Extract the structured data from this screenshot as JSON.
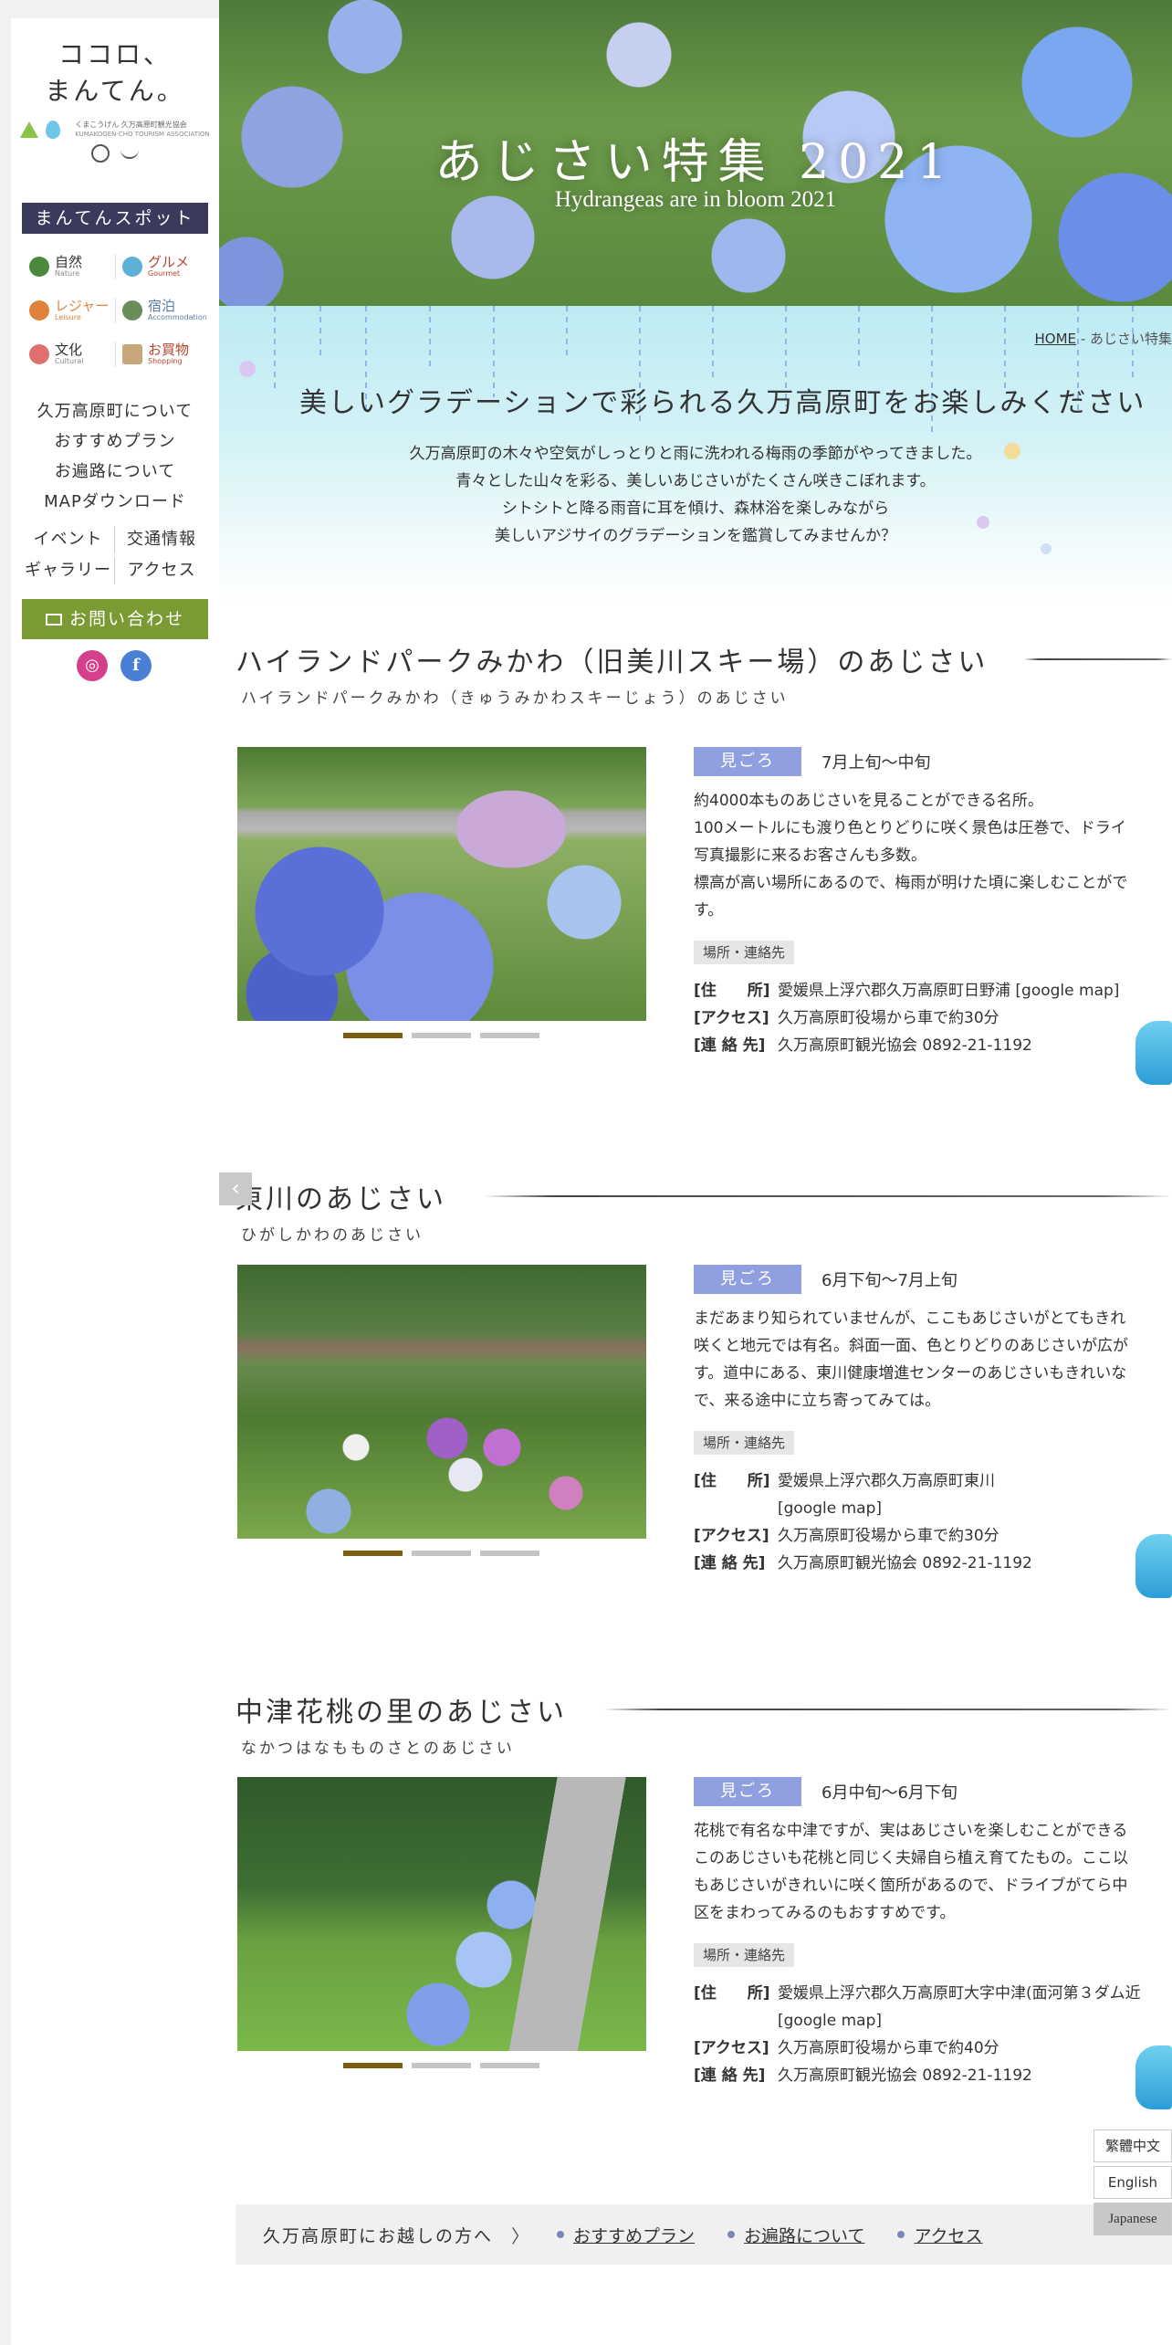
{
  "logo": {
    "main_line1": "ココロ、",
    "main_line2": "まんてん。",
    "sub": "くまこうげん 久万高原町観光協会",
    "sub_en": "KUMAKOGEN-CHO TOURISM ASSOCIATION"
  },
  "sidebar": {
    "spot_title": "まんてんスポット",
    "spots": [
      {
        "jp": "自然",
        "en": "Nature",
        "icon": "tree-icon",
        "color": "#4b8a3a",
        "text_color": "#333333"
      },
      {
        "jp": "グルメ",
        "en": "Gourmet",
        "icon": "plate-icon",
        "color": "#5fb0d8",
        "text_color": "#b6452c"
      },
      {
        "jp": "レジャー",
        "en": "Leisure",
        "icon": "hat-icon",
        "color": "#e0823a",
        "text_color": "#e0823a"
      },
      {
        "jp": "宿泊",
        "en": "Accommodation",
        "icon": "house-icon",
        "color": "#6a8e5a",
        "text_color": "#5a7fa8"
      },
      {
        "jp": "文化",
        "en": "Cultural",
        "icon": "heart-icon",
        "color": "#e07070",
        "text_color": "#333333"
      },
      {
        "jp": "お買物",
        "en": "Shopping",
        "icon": "bag-icon",
        "color": "#c9a77a",
        "text_color": "#b6452c"
      }
    ],
    "nav": [
      "久万高原町について",
      "おすすめプラン",
      "お遍路について",
      "MAPダウンロード"
    ],
    "nav2": [
      "イベント",
      "交通情報",
      "ギャラリー",
      "アクセス"
    ],
    "contact": "お問い合わせ",
    "social": {
      "instagram": "instagram-icon",
      "facebook": "facebook-icon"
    }
  },
  "hero": {
    "title": "あじさい特集 2021",
    "subtitle": "Hydrangeas are in bloom 2021"
  },
  "breadcrumb": {
    "home": "HOME",
    "current": "- あじさい特集"
  },
  "intro": {
    "heading": "美しいグラデーションで彩られる久万高原町をお楽しみください",
    "lines": [
      "久万高原町の木々や空気がしっとりと雨に洗われる梅雨の季節がやってきました。",
      "青々とした山々を彩る、美しいあじさいがたくさん咲きこぼれます。",
      "シトシトと降る雨音に耳を傾け、森林浴を楽しみながら",
      "美しいアジサイのグラデーションを鑑賞してみませんか？"
    ]
  },
  "labels": {
    "badge": "見ごろ",
    "info_tag": "場所・連絡先",
    "k_address": "[住　　所]",
    "k_access": "[アクセス]",
    "k_contact": "[連 絡 先]"
  },
  "spots_sections": [
    {
      "title": "ハイランドパークみかわ（旧美川スキー場）のあじさい",
      "kana": "ハイランドパークみかわ（きゅうみかわスキーじょう）のあじさい",
      "season": "7月上旬～中旬",
      "desc": [
        "約4000本ものあじさいを見ることができる名所。",
        "100メートルにも渡り色とりどりに咲く景色は圧巻で、ドライ",
        "写真撮影に来るお客さんも多数。",
        "標高が高い場所にあるので、梅雨が明けた頃に楽しむことがで",
        "す。"
      ],
      "address": "愛媛県上浮穴郡久万高原町日野浦 [google map]",
      "address2": "",
      "access": "久万高原町役場から車で約30分",
      "contact": "久万高原町観光協会 0892-21-1192"
    },
    {
      "title": "東川のあじさい",
      "kana": "ひがしかわのあじさい",
      "season": "6月下旬～7月上旬",
      "desc": [
        "まだあまり知られていませんが、ここもあじさいがとてもきれ",
        "咲くと地元では有名。斜面一面、色とりどりのあじさいが広が",
        "す。道中にある、東川健康増進センターのあじさいもきれいな",
        "で、来る途中に立ち寄ってみては。"
      ],
      "address": "愛媛県上浮穴郡久万高原町東川",
      "address2": "[google map]",
      "access": "久万高原町役場から車で約30分",
      "contact": "久万高原町観光協会 0892-21-1192"
    },
    {
      "title": "中津花桃の里のあじさい",
      "kana": "なかつはなもものさとのあじさい",
      "season": "6月中旬～6月下旬",
      "desc": [
        "花桃で有名な中津ですが、実はあじさいを楽しむことができる",
        "このあじさいも花桃と同じく夫婦自ら植え育てたもの。ここ以",
        "もあじさいがきれいに咲く箇所があるので、ドライブがてら中",
        "区をまわってみるのもおすすめです。"
      ],
      "address": "愛媛県上浮穴郡久万高原町大字中津(面河第３ダム近",
      "address2": "[google map]",
      "access": "久万高原町役場から車で約40分",
      "contact": "久万高原町観光協会 0892-21-1192"
    }
  ],
  "footer_nav": {
    "lead": "久万高原町にお越しの方へ",
    "arrow": "〉",
    "links": [
      "おすすめプラン",
      "お遍路について",
      "アクセス"
    ]
  },
  "languages": [
    "繁體中文",
    "English",
    "Japanese"
  ],
  "colors": {
    "accent_badge": "#8f9fe0",
    "contact_button": "#7a9a34",
    "spot_title_bg": "#3a3a5c",
    "dot_active": "#7b5e12"
  }
}
